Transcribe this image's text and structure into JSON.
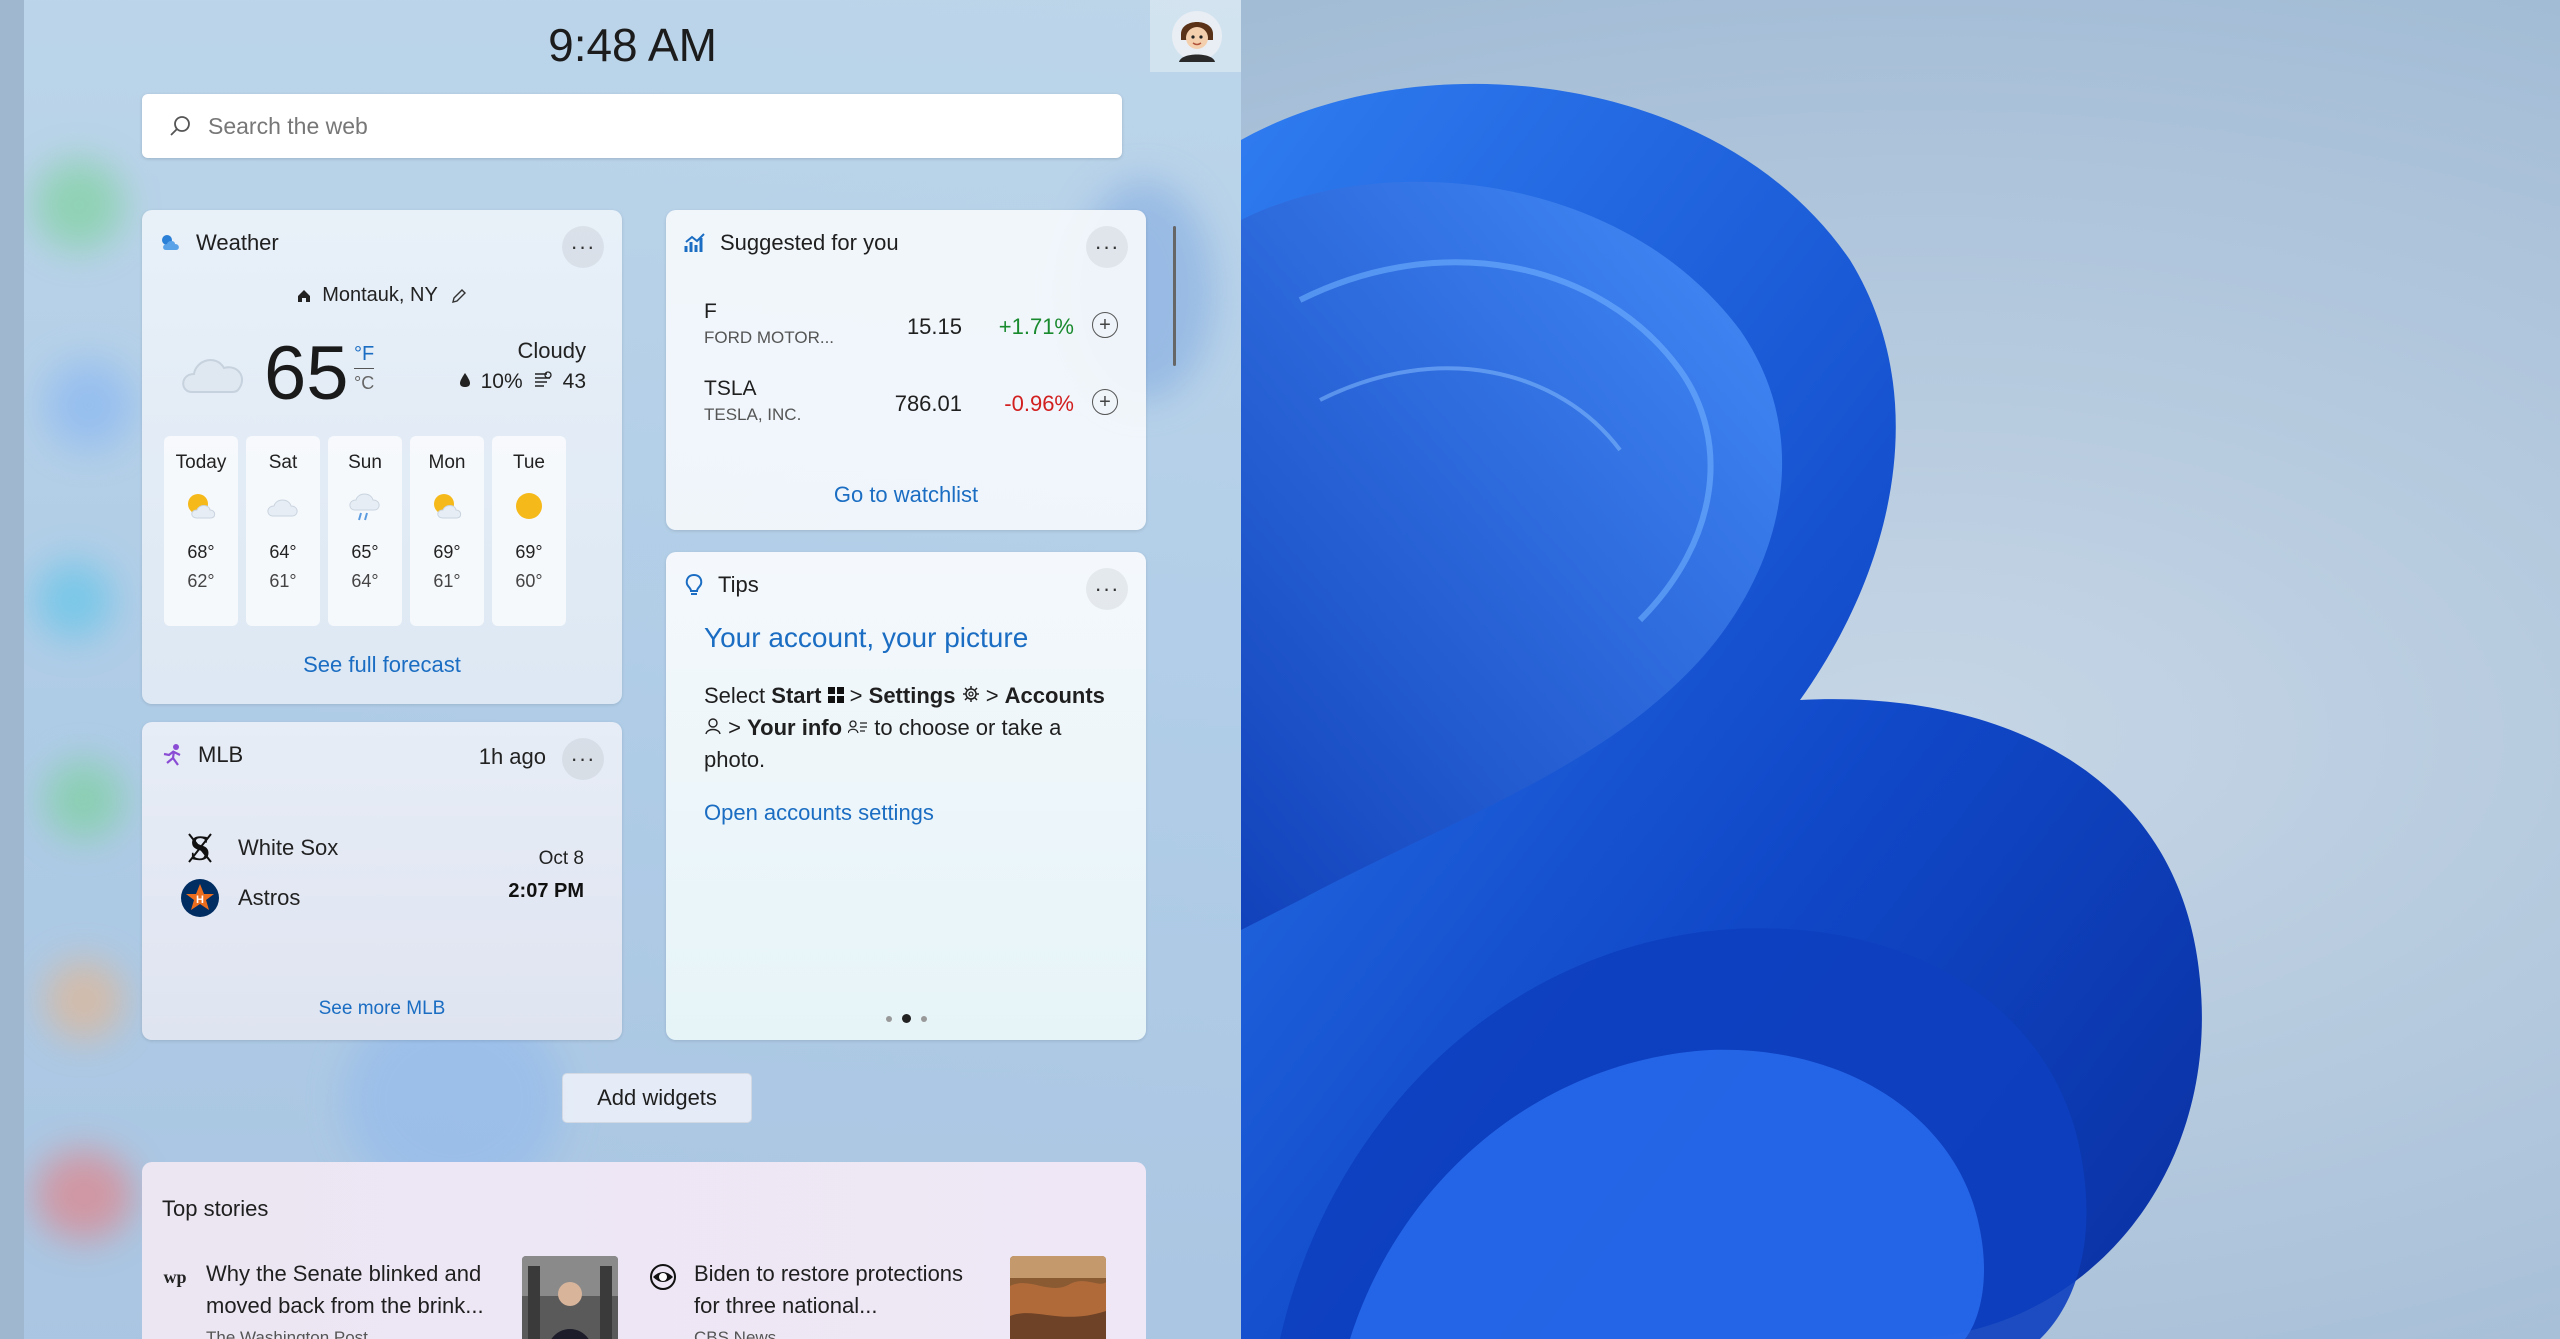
{
  "clock": "9:48 AM",
  "search": {
    "placeholder": "Search the web"
  },
  "weather": {
    "title": "Weather",
    "location": "Montauk, NY",
    "temp": "65",
    "unit_f": "°F",
    "unit_c": "°C",
    "condition": "Cloudy",
    "precip": "10%",
    "aqi": "43",
    "forecast": [
      {
        "day": "Today",
        "hi": "68°",
        "lo": "62°",
        "icon": "partly-sunny-icon"
      },
      {
        "day": "Sat",
        "hi": "64°",
        "lo": "61°",
        "icon": "cloudy-icon"
      },
      {
        "day": "Sun",
        "hi": "65°",
        "lo": "64°",
        "icon": "rain-icon"
      },
      {
        "day": "Mon",
        "hi": "69°",
        "lo": "61°",
        "icon": "partly-sunny-icon"
      },
      {
        "day": "Tue",
        "hi": "69°",
        "lo": "60°",
        "icon": "sunny-icon"
      }
    ],
    "link": "See full forecast"
  },
  "stocks": {
    "title": "Suggested for you",
    "rows": [
      {
        "symbol": "F",
        "name": "FORD MOTOR...",
        "price": "15.15",
        "change": "+1.71%",
        "change_color": "#1a8a2e"
      },
      {
        "symbol": "TSLA",
        "name": "TESLA, INC.",
        "price": "786.01",
        "change": "-0.96%",
        "change_color": "#d21f1f"
      }
    ],
    "link": "Go to watchlist"
  },
  "tips": {
    "title": "Tips",
    "heading": "Your account, your picture",
    "body": {
      "w1": "Select",
      "start": "Start",
      "gt": ">",
      "settings": "Settings",
      "accounts": "Accounts",
      "your_info": "Your info",
      "w2": "to choose or take a photo."
    },
    "link": "Open accounts settings"
  },
  "mlb": {
    "title": "MLB",
    "ago": "1h ago",
    "team1": "White Sox",
    "team2": "Astros",
    "date": "Oct 8",
    "time": "2:07 PM",
    "link": "See more MLB"
  },
  "add_widgets": "Add widgets",
  "stories": {
    "title": "Top stories",
    "items": [
      {
        "headline": "Why the Senate blinked and moved back from the brink...",
        "source": "The Washington Post",
        "src_icon": "wp"
      },
      {
        "headline": "Biden to restore protections for three national...",
        "source": "CBS News",
        "src_icon": "eye"
      }
    ]
  },
  "colors": {
    "accent": "#1a6dc2",
    "up": "#1a8a2e",
    "down": "#d21f1f"
  }
}
